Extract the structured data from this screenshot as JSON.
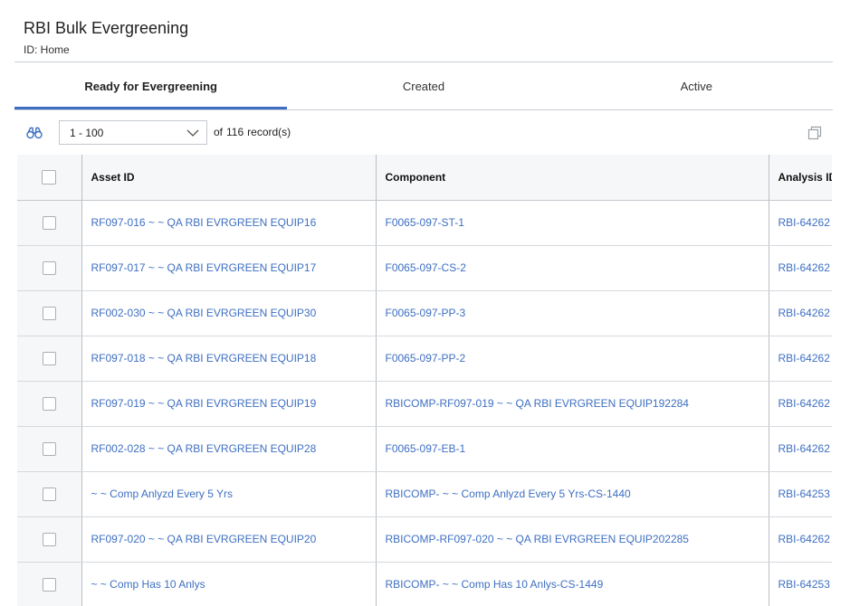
{
  "page": {
    "title": "RBI Bulk Evergreening",
    "subtitle": "ID: Home"
  },
  "tabs": [
    {
      "label": "Ready for Evergreening",
      "active": true
    },
    {
      "label": "Created",
      "active": false
    },
    {
      "label": "Active",
      "active": false
    }
  ],
  "toolbar": {
    "range": "1 - 100",
    "of_label": "of",
    "total": "116",
    "records_label": "record(s)"
  },
  "table": {
    "columns": [
      "Asset ID",
      "Component",
      "Analysis ID"
    ],
    "rows": [
      {
        "asset": "RF097-016 ~ ~ QA RBI EVRGREEN EQUIP16",
        "component": "F0065-097-ST-1",
        "analysis": "RBI-64262"
      },
      {
        "asset": "RF097-017 ~ ~ QA RBI EVRGREEN EQUIP17",
        "component": "F0065-097-CS-2",
        "analysis": "RBI-64262"
      },
      {
        "asset": "RF002-030 ~ ~ QA RBI EVRGREEN EQUIP30",
        "component": "F0065-097-PP-3",
        "analysis": "RBI-64262"
      },
      {
        "asset": "RF097-018 ~ ~ QA RBI EVRGREEN EQUIP18",
        "component": "F0065-097-PP-2",
        "analysis": "RBI-64262"
      },
      {
        "asset": "RF097-019 ~ ~ QA RBI EVRGREEN EQUIP19",
        "component": "RBICOMP-RF097-019 ~ ~ QA RBI EVRGREEN EQUIP192284",
        "analysis": "RBI-64262"
      },
      {
        "asset": "RF002-028 ~ ~ QA RBI EVRGREEN EQUIP28",
        "component": "F0065-097-EB-1",
        "analysis": "RBI-64262"
      },
      {
        "asset": "~ ~ Comp Anlyzd Every 5 Yrs",
        "component": "RBICOMP- ~ ~ Comp Anlyzd Every 5 Yrs-CS-1440",
        "analysis": "RBI-64253"
      },
      {
        "asset": "RF097-020 ~ ~ QA RBI EVRGREEN EQUIP20",
        "component": "RBICOMP-RF097-020 ~ ~ QA RBI EVRGREEN EQUIP202285",
        "analysis": "RBI-64262"
      },
      {
        "asset": "~ ~ Comp Has 10 Anlys",
        "component": "RBICOMP- ~ ~ Comp Has 10 Anlys-CS-1449",
        "analysis": "RBI-64253"
      }
    ]
  },
  "colors": {
    "accent": "#3e6fc2",
    "link": "#3e6fc2"
  },
  "icons": {
    "find": "binoculars-icon",
    "copy": "copy-icon",
    "dropdown": "chevron-down-icon"
  }
}
